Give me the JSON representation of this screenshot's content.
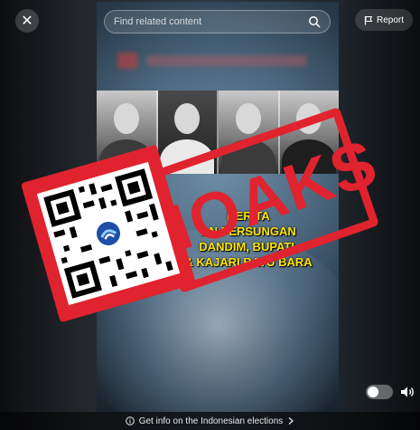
{
  "header": {
    "search_placeholder": "Find related content",
    "report_label": "Report",
    "close_label": "✕"
  },
  "video": {
    "caption_lines": [
      "BERITA",
      "AN PERSUNGAN",
      "DANDIM, BUPATI,",
      "& KAJARI BATU BARA"
    ]
  },
  "stamp": {
    "text": "HOAKS"
  },
  "footer": {
    "info_text": "Get info on the Indonesian elections"
  },
  "colors": {
    "stamp_red": "#e0232e",
    "caption_yellow": "#ffe400"
  },
  "icons": {
    "close": "close-icon",
    "search": "search-icon",
    "report": "flag-icon",
    "volume": "volume-icon",
    "info": "info-icon",
    "chevron": "chevron-right-icon"
  }
}
